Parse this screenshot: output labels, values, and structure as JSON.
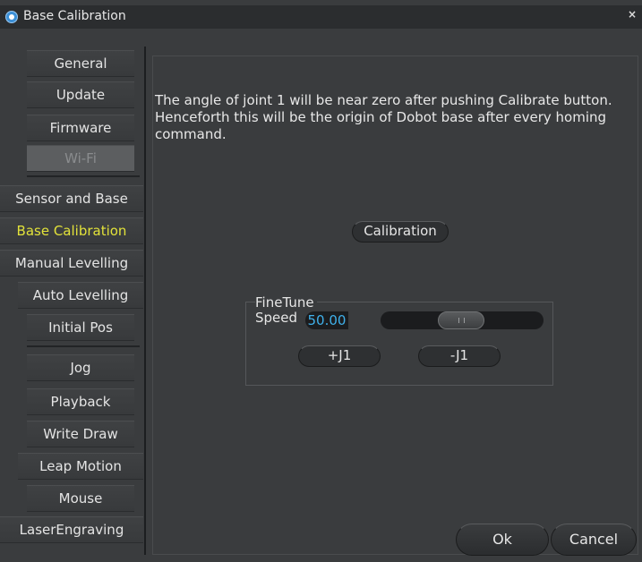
{
  "window": {
    "title": "Base Calibration",
    "close_glyph": "×",
    "app_icon": "dobot-logo-icon"
  },
  "sidebar": {
    "items": [
      {
        "label": "General",
        "state": "normal"
      },
      {
        "label": "Update",
        "state": "normal"
      },
      {
        "label": "Firmware",
        "state": "normal"
      },
      {
        "label": "Wi-Fi",
        "state": "disabled"
      },
      {
        "label": "Sensor and Base",
        "state": "normal"
      },
      {
        "label": "Base Calibration",
        "state": "active"
      },
      {
        "label": "Manual Levelling",
        "state": "normal"
      },
      {
        "label": "Auto Levelling",
        "state": "normal"
      },
      {
        "label": "Initial Pos",
        "state": "normal"
      },
      {
        "label": "Jog",
        "state": "normal"
      },
      {
        "label": "Playback",
        "state": "normal"
      },
      {
        "label": "Write  Draw",
        "state": "normal"
      },
      {
        "label": "Leap Motion",
        "state": "normal"
      },
      {
        "label": "Mouse",
        "state": "normal"
      },
      {
        "label": "LaserEngraving",
        "state": "normal"
      }
    ]
  },
  "main": {
    "description": "The angle of joint 1 will be near zero after pushing Calibrate button. Henceforth this will be the origin of Dobot base after every homing command.",
    "calibration_button": "Calibration",
    "finetune": {
      "legend": "FineTune",
      "speed_label": "Speed",
      "speed_value": "50.00",
      "speed_level_fraction": 0.5,
      "plus_j1": "+J1",
      "minus_j1": "-J1"
    },
    "ok_button": "Ok",
    "cancel_button": "Cancel"
  },
  "colors": {
    "background": "#3a3c3e",
    "active_nav_text": "#e2e23a",
    "speed_value_text": "#3fb0ea"
  }
}
